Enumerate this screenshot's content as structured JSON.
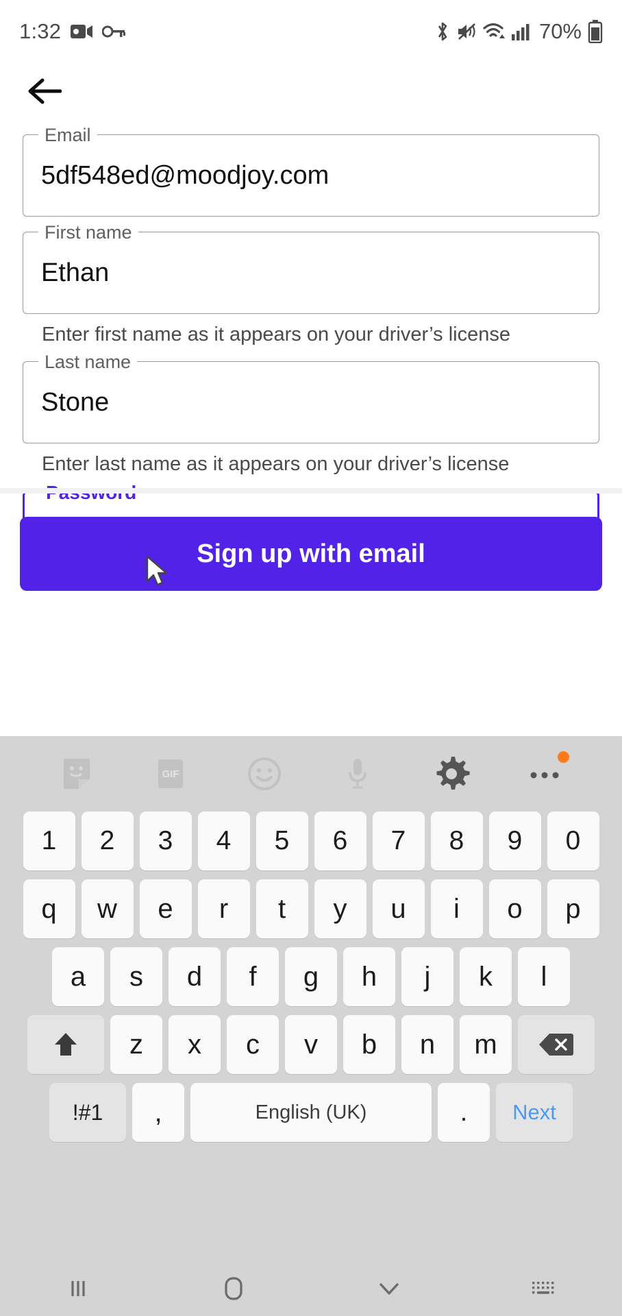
{
  "status_bar": {
    "time": "1:32",
    "battery_percent": "70%",
    "left_icons": [
      "video-camera-icon",
      "key-icon"
    ],
    "right_icons": [
      "bluetooth-icon",
      "mute-icon",
      "wifi-icon",
      "cellular-signal-icon",
      "battery-icon"
    ]
  },
  "colors": {
    "accent": "#5222e8",
    "keyboard_bg": "#d4d4d4",
    "key_bg": "#fafafa",
    "next_key_text": "#4a9af5",
    "badge": "#ff7a18"
  },
  "header": {
    "back_label": "Back"
  },
  "form": {
    "fields": [
      {
        "label": "Email",
        "value": "5df548ed@moodjoy.com",
        "helper": "",
        "focused": false
      },
      {
        "label": "First name",
        "value": "Ethan",
        "helper": "Enter first name as it appears on your driver’s license",
        "focused": false
      },
      {
        "label": "Last name",
        "value": "Stone",
        "helper": "Enter last name as it appears on your driver’s license",
        "focused": false
      },
      {
        "label": "Password",
        "value": "",
        "helper": "",
        "focused": true
      }
    ],
    "submit_label": "Sign up with email"
  },
  "keyboard": {
    "toolbar": [
      "sticker-icon",
      "gif-icon",
      "emoji-icon",
      "microphone-icon",
      "settings-gear-icon",
      "more-options-icon"
    ],
    "gif_label": "GIF",
    "rows": {
      "numbers": [
        "1",
        "2",
        "3",
        "4",
        "5",
        "6",
        "7",
        "8",
        "9",
        "0"
      ],
      "top": [
        "q",
        "w",
        "e",
        "r",
        "t",
        "y",
        "u",
        "i",
        "o",
        "p"
      ],
      "home": [
        "a",
        "s",
        "d",
        "f",
        "g",
        "h",
        "j",
        "k",
        "l"
      ],
      "bottom": [
        "z",
        "x",
        "c",
        "v",
        "b",
        "n",
        "m"
      ]
    },
    "shift_label": "Shift",
    "backspace_label": "Backspace",
    "symbols_label": "!#1",
    "comma_label": ",",
    "space_label": "English (UK)",
    "period_label": ".",
    "next_label": "Next"
  },
  "navbar": {
    "items": [
      "recents-icon",
      "home-icon",
      "hide-keyboard-icon",
      "keyboard-switch-icon"
    ]
  }
}
